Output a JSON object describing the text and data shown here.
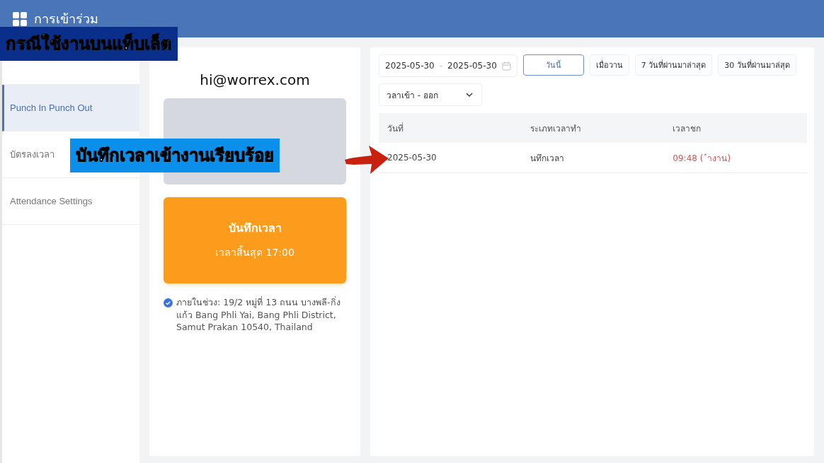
{
  "header": {
    "title": "การเข้าร่วม"
  },
  "sidebar": {
    "items": [
      {
        "label": "Punch In Punch Out",
        "selected": true
      },
      {
        "label": "บัตรลงเวลา",
        "selected": false
      },
      {
        "label": "Attendance Settings",
        "selected": false
      }
    ]
  },
  "profile": {
    "email": "hi@worrex.com"
  },
  "punch_buttons": [
    {
      "kind": "done"
    },
    {
      "kind": "active",
      "label": "บันทึกเวลา",
      "sub": "เวลาสิ้นสุด 17:00"
    }
  ],
  "location": {
    "verified": true,
    "text": "ภายในช่วง: 19/2 หมู่ที่ 13 ถนน บางพลี-กิ่งแก้ว Bang Phli Yai, Bang Phli District, Samut Prakan 10540, Thailand"
  },
  "date_range": {
    "start": "2025-05-30",
    "separator": "-",
    "end": "2025-05-30"
  },
  "filters": [
    {
      "label": "วันนี้",
      "selected": true
    },
    {
      "label": "เมื่อวาน",
      "selected": false
    },
    {
      "label": "7 วันที่ผ่านมาล่าสุด",
      "selected": false
    },
    {
      "label": "30 วันที่ผ่านมาล่สุด",
      "selected": false
    }
  ],
  "type_select": {
    "value": "วลาเข้า - ออก"
  },
  "table": {
    "columns": [
      "วันที่",
      "ระเภทเวลาทำ",
      "เวลาชก"
    ],
    "rows": [
      {
        "date": "2025-05-30",
        "type": "นทึกเวลา",
        "time": "09:48 (ˆางาน)"
      }
    ]
  },
  "captions": [
    {
      "kind": "title",
      "text": "กรณีใช้งานบนแท็บเล็ต"
    },
    {
      "kind": "note",
      "text": "บันทึกเวลาเข้างานเรียบร้อย"
    }
  ]
}
